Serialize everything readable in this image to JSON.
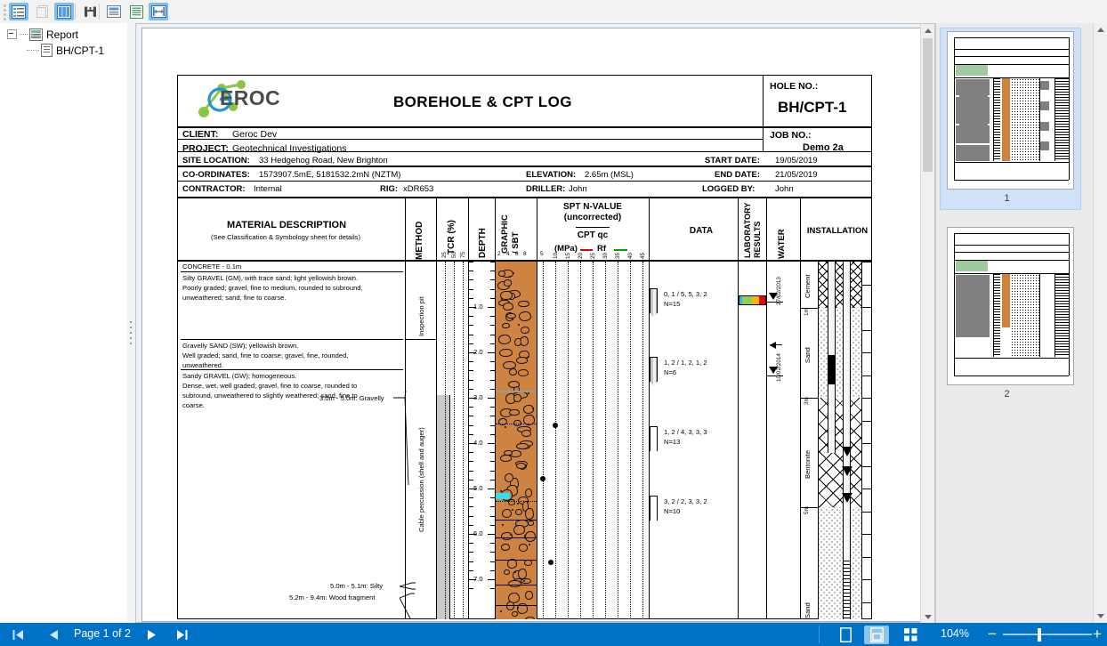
{
  "toolbar": {
    "buttons": [
      {
        "name": "outline-view-toggle",
        "icon": "outline-icon",
        "active": true
      },
      {
        "name": "page-view-button",
        "icon": "page-icon",
        "active": false
      },
      {
        "name": "thumbnail-panel-toggle",
        "icon": "thumbnails-icon",
        "active": true
      },
      {
        "name": "find-button",
        "icon": "binoculars-icon",
        "active": false
      },
      {
        "name": "single-page-layout-button",
        "icon": "single-page-icon",
        "active": false
      },
      {
        "name": "continuous-layout-button",
        "icon": "continuous-page-icon",
        "active": false
      },
      {
        "name": "fit-width-button",
        "icon": "fit-width-icon",
        "active": true
      }
    ]
  },
  "tree": {
    "root_label": "Report",
    "child_label": "BH/CPT-1"
  },
  "report": {
    "logo_text": "EROC",
    "title": "BOREHOLE & CPT LOG",
    "hole_no_label": "HOLE NO.:",
    "hole_no": "BH/CPT-1",
    "job_no_label": "JOB NO.:",
    "job_no": "Demo 2a",
    "fields": {
      "client_label": "CLIENT:",
      "client": "Geroc Dev",
      "project_label": "PROJECT:",
      "project": "Geotechnical Investigations",
      "site_label": "SITE LOCATION:",
      "site": "33 Hedgehog Road, New Brighton",
      "coords_label": "CO-ORDINATES:",
      "coords": "1573907.5mE, 5181532.2mN (NZTM)",
      "contractor_label": "CONTRACTOR:",
      "contractor": "Internal",
      "rig_label": "RIG:",
      "rig": "xDR653",
      "elevation_label": "ELEVATION:",
      "elevation": "2.65m (MSL)",
      "driller_label": "DRILLER:",
      "driller": "John",
      "start_date_label": "START DATE:",
      "start_date": "19/05/2019",
      "end_date_label": "END DATE:",
      "end_date": "21/05/2019",
      "logged_by_label": "LOGGED BY:",
      "logged_by": "John"
    },
    "columns": {
      "material": "MATERIAL DESCRIPTION",
      "material_sub": "(See Classification & Symbology sheet for details)",
      "method": "METHOD",
      "tcr": "TCR (%)",
      "depth": "DEPTH",
      "graphic": "GRAPHIC",
      "graphic2": "/ SBT",
      "spt_line1": "SPT N-VALUE",
      "spt_line2": "(uncorrected)",
      "spt_line3": "CPT qc",
      "spt_line4": "(MPa)",
      "spt_legend_rf": "Rf",
      "data": "DATA",
      "lab": "LABORATORY",
      "lab2": "RESULTS",
      "water": "WATER",
      "installation": "INSTALLATION"
    },
    "ticks": {
      "tcr": [
        "25",
        "50",
        "75"
      ],
      "sbt": [
        "2",
        "4",
        "6",
        "8"
      ],
      "spt": [
        "5",
        "10",
        "15",
        "20",
        "25",
        "30",
        "35",
        "40",
        "45"
      ],
      "depth": [
        "1.0",
        "2.0",
        "3.0",
        "4.0",
        "5.0",
        "6.0",
        "7.0"
      ]
    },
    "strata": [
      {
        "name": "concrete",
        "text": "CONCRETE - 0.1m"
      },
      {
        "name": "silty-gravel",
        "text": "Silty GRAVEL (GM), with trace sand; light yellowish brown.\nPoorly graded; gravel, fine to medium, rounded to subround,\nunweathered; sand, fine to coarse."
      },
      {
        "name": "gravelly-sand",
        "text": "Gravelly SAND (SW); yellowish brown.\nWell graded; sand, fine to coarse; gravel, fine, rounded,\nunweathered."
      },
      {
        "name": "sandy-gravel",
        "text": "Sandy GRAVEL (GW); homogeneous.\nDense, wet, well graded; gravel, fine to coarse, rounded to\nsubround, unweathered to slightly weathered; sand, fine to\ncoarse."
      }
    ],
    "annotations": [
      {
        "name": "annotation-gravelly",
        "text": "3.0m - 5.0m: Gravelly"
      },
      {
        "name": "annotation-silty",
        "text": "5.0m - 5.1m: Silty"
      },
      {
        "name": "annotation-wood",
        "text": "5.2m - 9.4m: Wood fragment"
      }
    ],
    "methods": [
      {
        "name": "method-inspection-pit",
        "text": "Inspection pit"
      },
      {
        "name": "method-cable-percussion",
        "text": "Cable percussion (shell and auger)"
      }
    ],
    "spt_tests": [
      {
        "blows": "0, 1 / 5, 5, 3, 2",
        "n": "N=15"
      },
      {
        "blows": "1, 2 / 1, 2, 1, 2",
        "n": "N=6"
      },
      {
        "blows": "1, 2 / 4, 3, 3, 3",
        "n": "N=13"
      },
      {
        "blows": "3, 2 / 2, 3, 3, 2",
        "n": "N=10"
      }
    ],
    "water_readings": [
      {
        "date": "27/02/2013",
        "type": "filled-triangle"
      },
      {
        "date": "10/02/2014",
        "type": "filled-triangle"
      }
    ],
    "installation_layers": [
      {
        "material": "Cement",
        "depth": "1m"
      },
      {
        "material": "Sand",
        "depth": "3m"
      },
      {
        "material": "Bentonite",
        "depth": "5m"
      },
      {
        "material": "Sand",
        "depth": ""
      }
    ],
    "colors": {
      "graphic_fill": "#cf8340",
      "rf_legend": "#00a000",
      "qc_legend": "#e00000",
      "lab_bar": [
        "#22b8e8",
        "#8fd14f",
        "#ffb400",
        "#ee0000"
      ],
      "highlight": "#2ce0f0"
    }
  },
  "thumbnails": {
    "items": [
      {
        "label": "1",
        "selected": true
      },
      {
        "label": "2",
        "selected": false
      }
    ]
  },
  "status": {
    "first_page_label": "first-page",
    "prev_page_label": "previous-page",
    "page_text": "Page 1 of 2",
    "next_page_label": "next-page",
    "last_page_label": "last-page",
    "zoom_text": "104%",
    "zoom_out": "−",
    "zoom_in": "+"
  }
}
